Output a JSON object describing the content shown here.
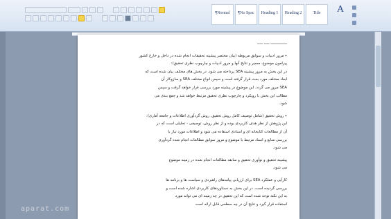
{
  "ribbon": {
    "tabs": [],
    "styles": [
      {
        "preview": "¶Normal",
        "label": ""
      },
      {
        "preview": "¶No Spac",
        "label": ""
      },
      {
        "preview": "Heading 1",
        "label": ""
      },
      {
        "preview": "Heading 2",
        "label": ""
      },
      {
        "preview": "Title",
        "label": ""
      }
    ],
    "change_styles_glyph": "A",
    "edit_items": [
      "",
      "",
      ""
    ]
  },
  "document": {
    "lines": [
      "ـــــــــــــــ ـــــ ـــــ",
      "",
      "٭ مرور ادبیات و سوابق مربوطه (بیان مختصر پیشینه تحقیقات انجام شده در داخل و خارج کشور",
      "پیرامون موضوع، مسیر و نتایج آنها و مرور ادبیات و چارچوب نظری تحقیق):",
      "در این بخش به مرور پیشینه SEA پرداخته می شود. در بخش های مختلف بیان شده است که",
      "ابعاد مختلف مورد بحث قرار گرفته است و سپس انواع مختلف SEA و سازوکار آن",
      "SEA مرور می گردد. این موضوع در پیشینه مورد بررسی قرار خواهد گرفت و سپس",
      "مطالب این بخش با رویکرد و چارچوب نظری تحقیق مرتبط خواهد شد و جمع بندی می",
      "شود.",
      "",
      "٭ روش تحقیق (شامل توصیف کامل روش تحقیق، روش گردآوری اطلاعات و جامعه آماری):",
      "این پژوهش از نظر هدف کاربردی بوده و از نظر روش، توصیفی - تحلیلی است که در",
      "آن از مطالعات کتابخانه ای و اسنادی استفاده می شود و اطلاعات مورد نیاز با",
      "بررسی منابع و اسناد مرتبط با موضوع و مرور سوابق مطالعات انجام شده گردآوری",
      "می شود.",
      "",
      "پیشینه تحقیق و نوآوری تحقیق و سابقه مطالعات انجام شده در زمینه موضوع",
      "می شود.",
      "",
      "کارآیی و عملکرد SEA برای ارزیابی پیامدهای راهبردی و سیاست ها و برنامه ها",
      "بررسی گردیده است. در این بخش به دستاوردهای کاربردی اشاره شده است و",
      "به این نکته توجه شده است که این تحقیق در چه زمینه ای می تواند مورد",
      "استفاده قرار گیرد و نتایج آن در چه سطحی قابل ارائه است"
    ]
  },
  "watermark": "aparat.com"
}
